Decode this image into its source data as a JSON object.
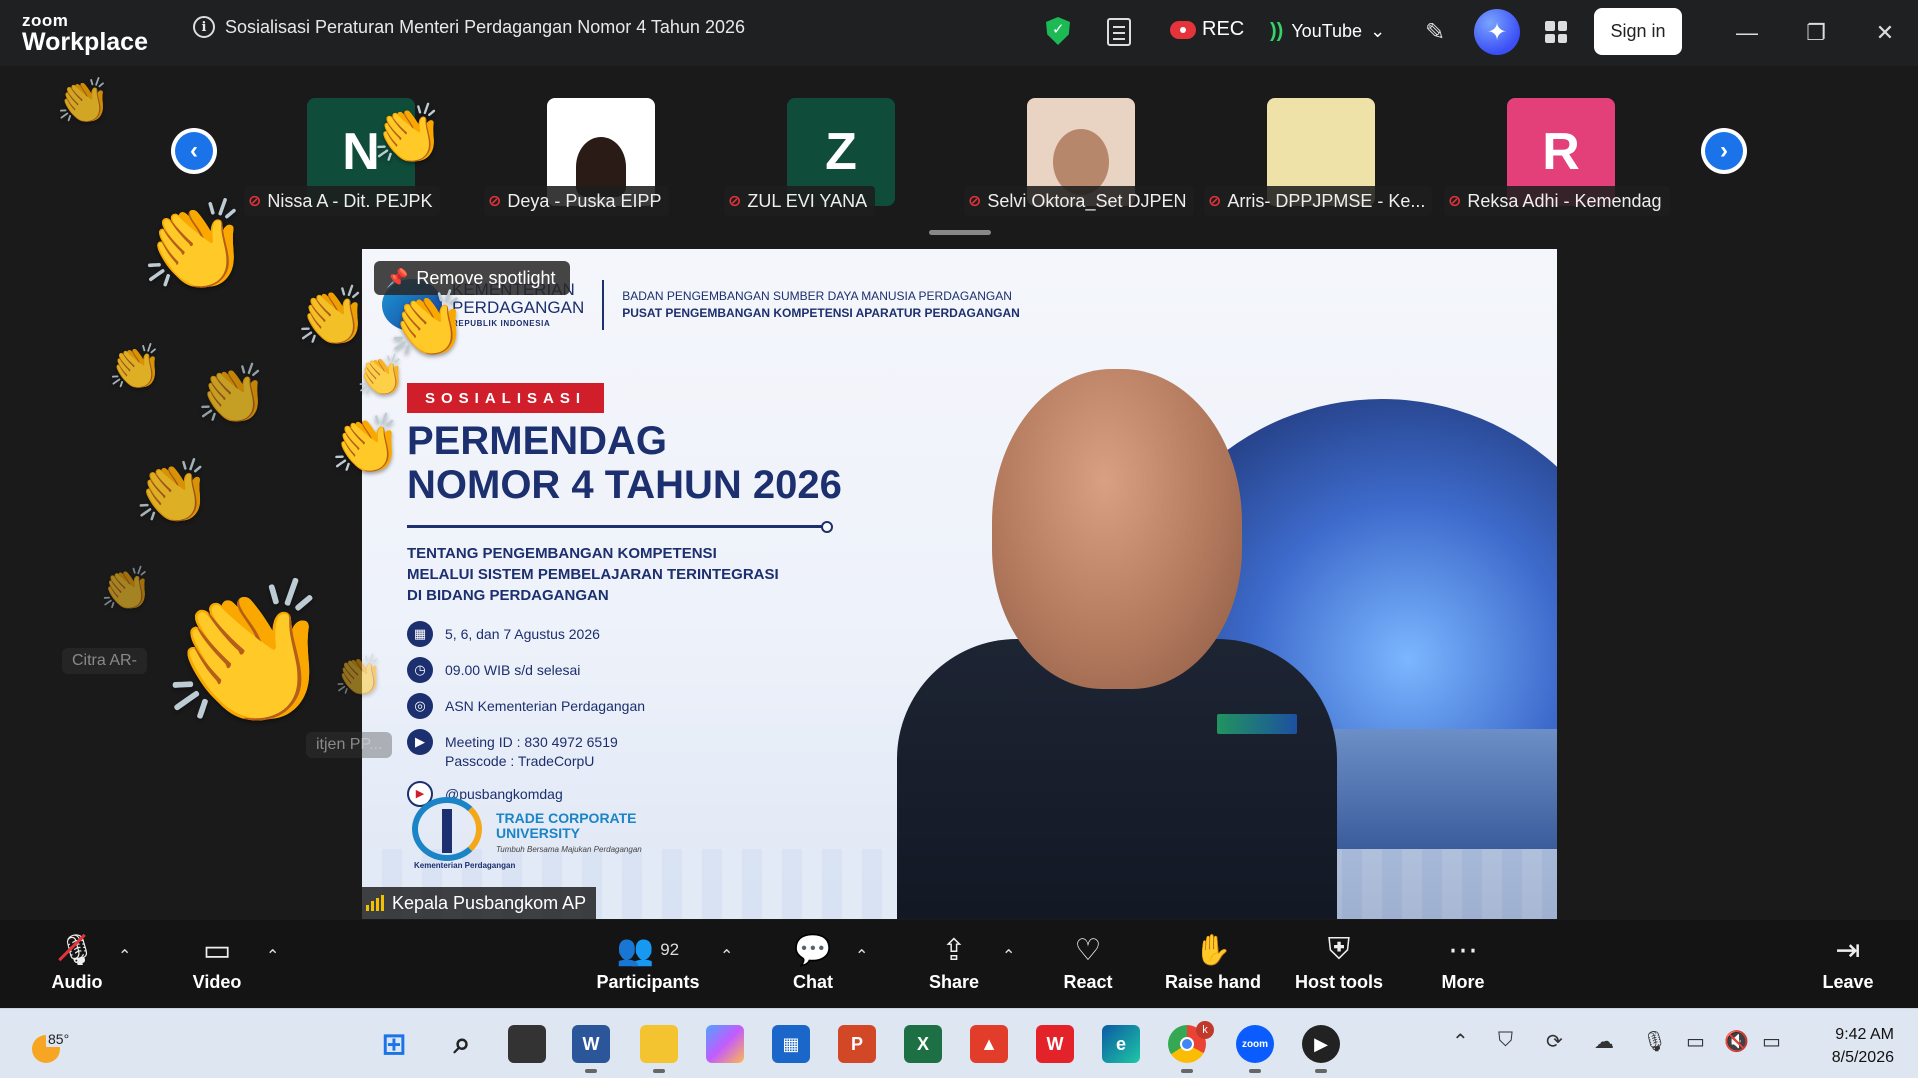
{
  "titlebar": {
    "brand_small": "zoom",
    "brand_big": "Workplace",
    "meeting_title": "Sosialisasi Peraturan Menteri Perdagangan Nomor 4 Tahun 2026",
    "rec_label": "REC",
    "stream_label": "YouTube",
    "signin_label": "Sign in",
    "icons": [
      "info-icon",
      "shield-icon",
      "notes-icon",
      "cloud-record-icon",
      "live-stream-icon",
      "annotate-icon",
      "ai-companion-icon",
      "apps-icon",
      "minimize-icon",
      "restore-icon",
      "close-icon"
    ]
  },
  "gallery": {
    "participants": [
      {
        "name": "Nissa A - Dit. PEJPK",
        "initial": "N",
        "tile_color": "#0f4d3a"
      },
      {
        "name": "Deya - Puska EIPP",
        "initial": "",
        "tile_color": "#ffffff"
      },
      {
        "name": "ZUL EVI YANA",
        "initial": "Z",
        "tile_color": "#0f4d3a"
      },
      {
        "name": "Selvi Oktora_Set DJPEN",
        "initial": "",
        "tile_color": "#e9d3c2"
      },
      {
        "name": "Arris- DPPJPMSE - Ke...",
        "initial": "",
        "tile_color": "#efe2a9"
      },
      {
        "name": "Reksa Adhi - Kemendag",
        "initial": "R",
        "tile_color": "#e3407a"
      }
    ]
  },
  "spotlight": {
    "remove_label": "Remove spotlight",
    "speaker_name": "Kepala Pusbangkom AP"
  },
  "slide": {
    "org_line1": "KEMENTERIAN",
    "org_line2": "PERDAGANGAN",
    "org_line3": "REPUBLIK INDONESIA",
    "agency_line1": "BADAN PENGEMBANGAN SUMBER DAYA MANUSIA PERDAGANGAN",
    "agency_line2": "PUSAT PENGEMBANGAN KOMPETENSI APARATUR PERDAGANGAN",
    "badge": "SOSIALISASI",
    "title_line1": "PERMENDAG",
    "title_line2": "NOMOR 4 TAHUN 2026",
    "about_line1": "TENTANG PENGEMBANGAN KOMPETENSI",
    "about_line2": "MELALUI SISTEM PEMBELAJARAN TERINTEGRASI",
    "about_line3": "DI BIDANG PERDAGANGAN",
    "date": "5, 6, dan 7 Agustus 2026",
    "time": "09.00 WIB s/d selesai",
    "audience": "ASN Kementerian Perdagangan",
    "meeting_id": "Meeting ID : 830 4972 6519",
    "passcode": "Passcode   : TradeCorpU",
    "youtube": "@pusbangkomdag",
    "tcu_line1": "TRADE CORPORATE",
    "tcu_line2": "UNIVERSITY",
    "tcu_tagline": "Tumbuh Bersama Majukan Perdagangan",
    "tcu_footer": "Kementerian Perdagangan"
  },
  "ghost_names": {
    "left1": "Citra AR-",
    "left2": "itjen PP..."
  },
  "toolbar": {
    "audio": "Audio",
    "video": "Video",
    "participants": "Participants",
    "participants_count": "92",
    "chat": "Chat",
    "share": "Share",
    "react": "React",
    "raise_hand": "Raise hand",
    "host_tools": "Host tools",
    "more": "More",
    "leave": "Leave"
  },
  "taskbar": {
    "temperature": "85°",
    "time": "9:42 AM",
    "date": "8/5/2026",
    "chrome_badge": "k",
    "zoom_label": "zoom"
  },
  "colors": {
    "accent_blue": "#1a73e8",
    "rec_red": "#e5333c",
    "secure_green": "#1db954",
    "slide_navy": "#1c2f6e",
    "slide_red": "#d01f2b"
  }
}
